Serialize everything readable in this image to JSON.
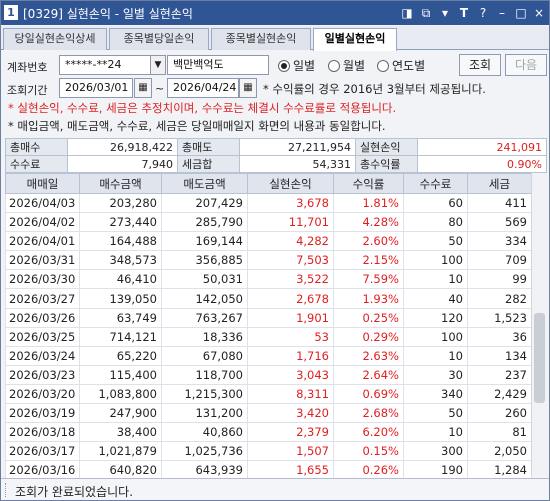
{
  "window": {
    "number": "1",
    "title": "[0329] 실현손익 - 일별 실현손익",
    "buttons": [
      "◨",
      "⧉",
      "▾",
      "T",
      "?",
      "–",
      "□",
      "×"
    ]
  },
  "tabs": [
    {
      "label": "당일실현손익상세"
    },
    {
      "label": "종목별당일손익"
    },
    {
      "label": "종목별실현손익"
    },
    {
      "label": "일별실현손익"
    }
  ],
  "filter": {
    "account_label": "계좌번호",
    "account_value": "*****-**24",
    "account_name": "백만백억도",
    "period_label": "조회기간",
    "date_from": "2026/03/01",
    "tilde": "~",
    "date_to": "2026/04/24",
    "note": "* 수익률의 경우 2016년 3월부터 제공됩니다.",
    "period_options": [
      "일별",
      "월별",
      "연도별"
    ],
    "selected_period": "일별",
    "query_button": "조회",
    "next_button": "다음"
  },
  "notes": {
    "red": "* 실현손익, 수수료, 세금은 추정치이며, 수수료는 체결시 수수료률로 적용됩니다.",
    "black": "* 매입금액, 매도금액, 수수료, 세금은 당일매매일지 화면의 내용과 동일합니다."
  },
  "summary": {
    "buy_total_label": "총매수",
    "buy_total": "26,918,422",
    "sell_total_label": "총매도",
    "sell_total": "27,211,954",
    "profit_label": "실현손익",
    "profit": "241,091",
    "fee_label": "수수료",
    "fee": "7,940",
    "tax_label": "세금합",
    "tax": "54,331",
    "return_label": "총수익률",
    "return": "0.90%"
  },
  "table": {
    "headers": [
      "매매일",
      "매수금액",
      "매도금액",
      "실현손익",
      "수익률",
      "수수료",
      "세금"
    ],
    "rows": [
      [
        "2026/04/03",
        "203,280",
        "207,429",
        "3,678",
        "1.81%",
        "60",
        "411"
      ],
      [
        "2026/04/02",
        "273,440",
        "285,790",
        "11,701",
        "4.28%",
        "80",
        "569"
      ],
      [
        "2026/04/01",
        "164,488",
        "169,144",
        "4,282",
        "2.60%",
        "50",
        "334"
      ],
      [
        "2026/03/31",
        "348,573",
        "356,885",
        "7,503",
        "2.15%",
        "100",
        "709"
      ],
      [
        "2026/03/30",
        "46,410",
        "50,031",
        "3,522",
        "7.59%",
        "10",
        "99"
      ],
      [
        "2026/03/27",
        "139,050",
        "142,050",
        "2,678",
        "1.93%",
        "40",
        "282"
      ],
      [
        "2026/03/26",
        "63,749",
        "763,267",
        "1,901",
        "0.25%",
        "120",
        "1,523"
      ],
      [
        "2026/03/25",
        "714,121",
        "18,336",
        "53",
        "0.29%",
        "100",
        "36"
      ],
      [
        "2026/03/24",
        "65,220",
        "67,080",
        "1,716",
        "2.63%",
        "10",
        "134"
      ],
      [
        "2026/03/23",
        "115,400",
        "118,700",
        "3,043",
        "2.64%",
        "30",
        "237"
      ],
      [
        "2026/03/20",
        "1,083,800",
        "1,215,300",
        "8,311",
        "0.69%",
        "340",
        "2,429"
      ],
      [
        "2026/03/19",
        "247,900",
        "131,200",
        "3,420",
        "2.68%",
        "50",
        "260"
      ],
      [
        "2026/03/18",
        "38,400",
        "40,860",
        "2,379",
        "6.20%",
        "10",
        "81"
      ],
      [
        "2026/03/17",
        "1,021,879",
        "1,025,736",
        "1,507",
        "0.15%",
        "300",
        "2,050"
      ],
      [
        "2026/03/16",
        "640,820",
        "643,939",
        "1,655",
        "0.26%",
        "190",
        "1,284"
      ]
    ]
  },
  "status": {
    "message": "조회가 완료되었습니다."
  }
}
